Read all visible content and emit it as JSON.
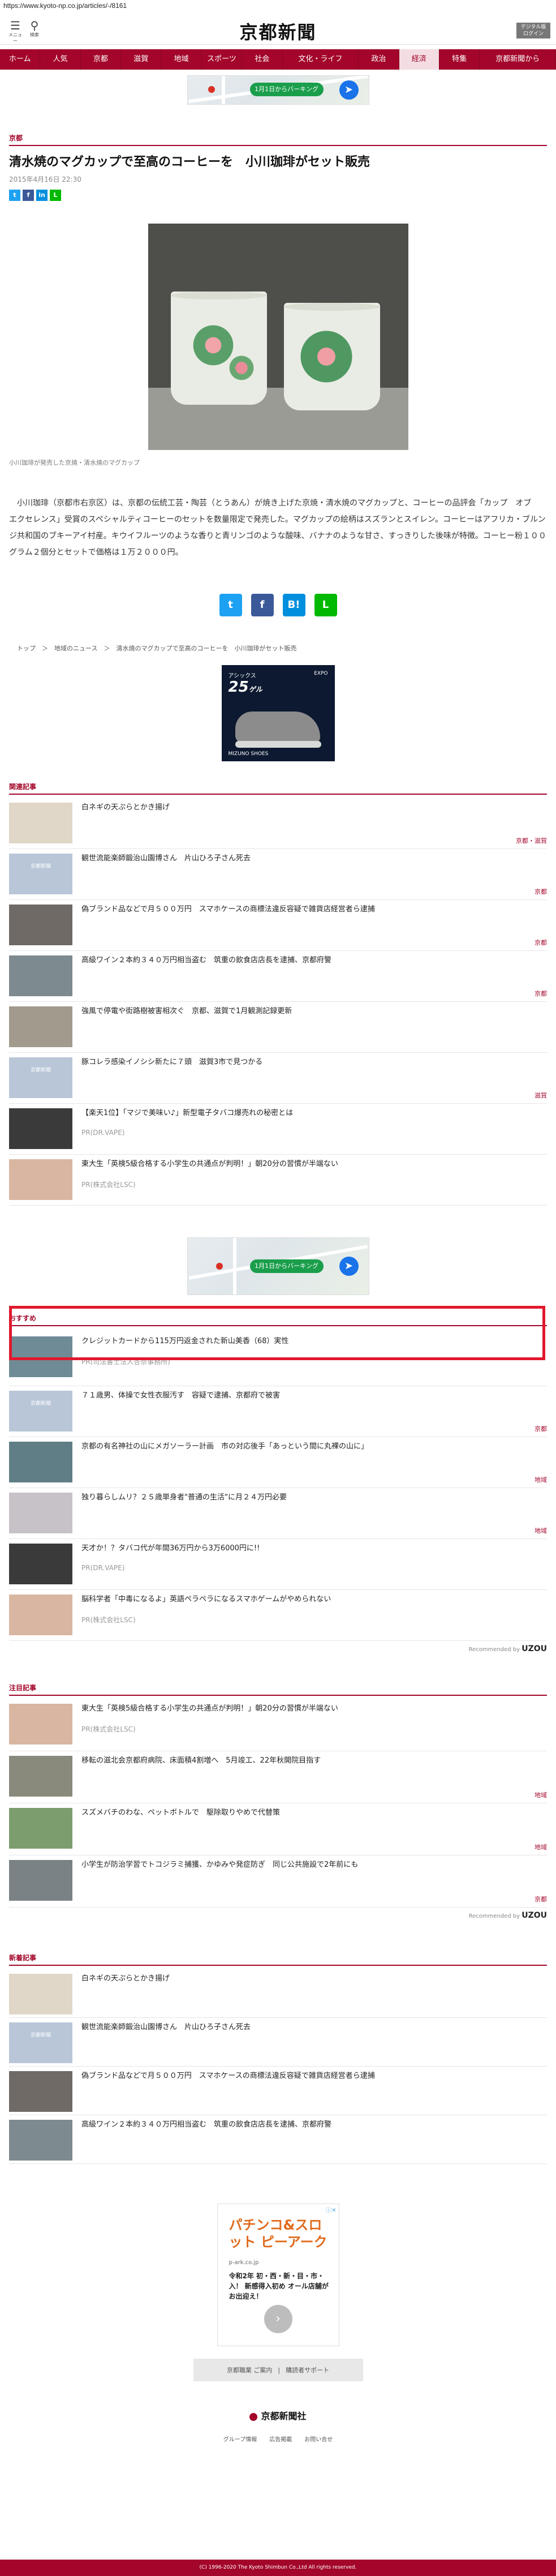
{
  "browser": {
    "url": "https://www.kyoto-np.co.jp/articles/-/8161"
  },
  "header": {
    "menu_label": "メニュー",
    "search_label": "検索",
    "logo": "京都新聞",
    "login_line1": "デジタル版",
    "login_line2": "ログイン"
  },
  "nav": [
    {
      "label": "ホーム"
    },
    {
      "label": "人気"
    },
    {
      "label": "京都"
    },
    {
      "label": "滋賀"
    },
    {
      "label": "地域"
    },
    {
      "label": "スポーツ"
    },
    {
      "label": "社会"
    },
    {
      "label": "文化・ライフ"
    },
    {
      "label": "政治"
    },
    {
      "label": "経済",
      "active": true
    },
    {
      "label": "特集"
    },
    {
      "label": "京都新聞から"
    }
  ],
  "ad_map": {
    "button_label": "1月1日からバーキング"
  },
  "article": {
    "category": "京都",
    "title": "清水焼のマグカップで至高のコーヒーを　小川珈琲がセット販売",
    "date": "2015年4月16日 22:30",
    "share_small": [
      "t",
      "f",
      "in",
      "L"
    ],
    "caption": "小川珈琲が発売した京焼・清水焼のマグカップ",
    "body": "小川珈琲（京都市右京区）は、京都の伝統工芸・陶芸（とうあん）が焼き上げた京焼・清水焼のマグカップと、コーヒーの品評会「カップ　オブ　エクセレンス」受賞のスペシャルティコーヒーのセットを数量限定で発売した。マグカップの絵柄はスズランとスイレン。コーヒーはアフリカ・ブルンジ共和国のブキーアイ村産。キウイフルーツのような香りと青リンゴのような酸味、バナナのような甘さ、すっきりした後味が特徴。コーヒー粉１００グラム２個分とセットで価格は１万２０００円。",
    "share_big": [
      "t",
      "f",
      "B!",
      "L"
    ],
    "breadcrumb": "トップ　＞　地域のニュース　＞　清水焼のマグカップで至高のコーヒーを　小川珈琲がセット販売"
  },
  "ad_shoe": {
    "top": "アシックス",
    "model": "25",
    "model_sub": "ゲル",
    "brand": "MIZUNO SHOES",
    "brand2": "EXPO"
  },
  "related": {
    "heading": "関連記事",
    "items": [
      {
        "title": "白ネギの天ぷらとかき揚げ",
        "tag": "京都・滋賀"
      },
      {
        "title": "観世流能楽師鍛治山園博さん　片山ひろ子さん死去",
        "tag": "京都"
      },
      {
        "title": "偽ブランド品などで月５００万円　スマホケースの商標法違反容疑で雑貨店経営者ら逮捕",
        "tag": "京都"
      },
      {
        "title": "高級ワイン２本約３４０万円相当盗む　筑重の飲食店店長を逮捕、京都府警",
        "tag": "京都"
      },
      {
        "title": "強風で停電や街路樹被害相次ぐ　京都、滋賀で1月観測記録更新",
        "tag": ""
      },
      {
        "title": "豚コレラ感染イノシシ新たに７頭　滋賀3市で見つかる",
        "tag": "滋賀"
      },
      {
        "title": "【楽天1位】「マジで美味い♪」新型電子タバコ爆売れの秘密とは",
        "sponsor": "PR(DR.VAPE)"
      },
      {
        "title": "東大生「英検5級合格する小学生の共通点が判明！」朝20分の習慣が半端ない",
        "sponsor": "PR(株式会社LSC)"
      }
    ]
  },
  "recommend": {
    "heading": "おすすめ",
    "items": [
      {
        "title": "クレジットカードから115万円返金された新山美香（68）実性",
        "sponsor": "PR(司法書士法人杏奈事務所)"
      },
      {
        "title": "７１歳男、体操で女性衣服汚す　容疑で逮捕、京都府で被害",
        "tag": "京都"
      },
      {
        "title": "京都の有名神社の山にメガソーラー計画　市の対応後手「あっという間に丸裸の山に」",
        "tag": "地域"
      },
      {
        "title": "独り暮らしムリ？２５歳単身者\"普通の生活\"に月２４万円必要",
        "tag": "地域"
      },
      {
        "title": "天才か！？タバコ代が年間36万円から3万6000円に!!",
        "sponsor": "PR(DR.VAPE)"
      },
      {
        "title": "脳科学者「中毒になるよ」英語ペラペラになるスマホゲームがやめられない",
        "sponsor": "PR(株式会社LSC)"
      }
    ],
    "recommended_by": "Recommended by",
    "uzou": "UZOU"
  },
  "attention": {
    "heading": "注目記事",
    "items": [
      {
        "title": "東大生「英検5級合格する小学生の共通点が判明！」朝20分の習慣が半端ない",
        "sponsor": "PR(株式会社LSC)"
      },
      {
        "title": "移転の滋北会京都府病院、床面積4割増へ　5月竣工、22年秋開院目指す",
        "tag": "地域"
      },
      {
        "title": "スズメバチのわな、ペットボトルで　駆除取りやめで代替策",
        "tag": "地域"
      },
      {
        "title": "小学生が防治学習でトコジラミ捕獲、かゆみや発症防ぎ　同じ公共施設で2年前にも",
        "tag": "京都"
      }
    ],
    "recommended_by": "Recommended by",
    "uzou": "UZOU"
  },
  "latest": {
    "heading": "新着記事",
    "items": [
      {
        "title": "白ネギの天ぷらとかき揚げ",
        "tag": ""
      },
      {
        "title": "観世流能楽師鍛治山園博さん　片山ひろ子さん死去",
        "tag": ""
      },
      {
        "title": "偽ブランド品などで月５００万円　スマホケースの商標法違反容疑で雑貨店経営者ら逮捕",
        "tag": ""
      },
      {
        "title": "高級ワイン２本約３４０万円相当盗む　筑重の飲食店店長を逮捕、京都府警",
        "tag": ""
      }
    ]
  },
  "ad_pachinko": {
    "title": "パチンコ&スロット ピーアーク",
    "sub": "p-ark.co.jp",
    "desc": "令和2年 初・西・新・目・市・入！ 新感得入初め オール店舗がお出迎え！",
    "go": "›",
    "ad_mark": "ⓘ✕"
  },
  "footer": {
    "pc_link": "京都職業 ご案内",
    "divider": "|",
    "support": "購読者サポート",
    "logo": "京都新聞社",
    "links": [
      "グループ情報",
      "広告掲載",
      "お問い合せ"
    ],
    "copyright": "(C) 1996-2020 The Kyoto Shimbun Co.,Ltd All rights reserved."
  },
  "colors": {
    "brand": "#a3062a",
    "highlight": "#e1182d",
    "twitter": "#1da1f2",
    "facebook": "#3b5998",
    "hatena": "#008fde",
    "line": "#00b900"
  }
}
